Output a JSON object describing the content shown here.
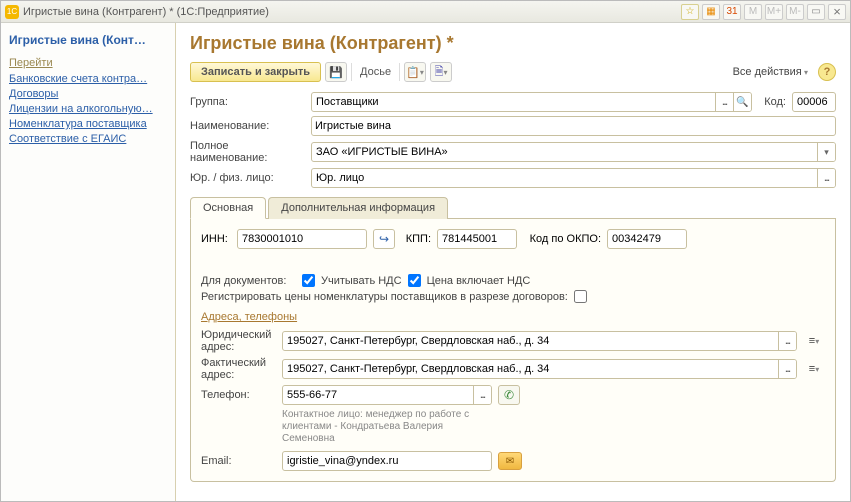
{
  "window": {
    "title": "Игристые вина (Контрагент) * (1С:Предприятие)"
  },
  "sidebar": {
    "title": "Игристые вина (Конт…",
    "section": "Перейти",
    "links": [
      "Банковские счета контра…",
      "Договоры",
      "Лицензии на алкогольную…",
      "Номенклатура поставщика",
      "Соответствие с ЕГАИС"
    ]
  },
  "page": {
    "title": "Игристые вина (Контрагент) *"
  },
  "toolbar": {
    "save_close": "Записать и закрыть",
    "dossier": "Досье",
    "all_actions": "Все действия"
  },
  "form": {
    "group_label": "Группа:",
    "group_value": "Поставщики",
    "code_label": "Код:",
    "code_value": "00006",
    "name_label": "Наименование:",
    "name_value": "Игристые вина",
    "fullname_label": "Полное наименование:",
    "fullname_value": "ЗАО «ИГРИСТЫЕ ВИНА»",
    "type_label": "Юр. / физ. лицо:",
    "type_value": "Юр. лицо"
  },
  "tabs": {
    "main": "Основная",
    "extra": "Дополнительная информация"
  },
  "main_tab": {
    "inn_label": "ИНН:",
    "inn_value": "7830001010",
    "kpp_label": "КПП:",
    "kpp_value": "781445001",
    "okpo_label": "Код по ОКПО:",
    "okpo_value": "00342479",
    "docs_label": "Для документов:",
    "vat_account": "Учитывать НДС",
    "vat_included": "Цена включает НДС",
    "register_prices": "Регистрировать цены номенклатуры поставщиков в разрезе договоров:",
    "addr_section": "Адреса, телефоны",
    "legal_addr_label": "Юридический адрес:",
    "legal_addr_value": "195027, Санкт-Петербург, Свердловская наб., д. 34",
    "actual_addr_label": "Фактический адрес:",
    "actual_addr_value": "195027, Санкт-Петербург, Свердловская наб., д. 34",
    "phone_label": "Телефон:",
    "phone_value": "555-66-77",
    "contact_hint": "Контактное лицо: менеджер по работе с клиентами - Кондратьева Валерия Семеновна",
    "email_label": "Email:",
    "email_value": "igristie_vina@yndex.ru"
  }
}
